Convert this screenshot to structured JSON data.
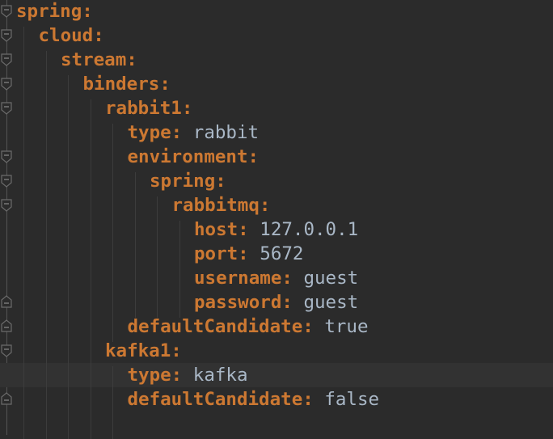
{
  "editor": {
    "language": "yaml",
    "colors": {
      "background": "#2b2b2b",
      "key": "#cc7832",
      "value": "#a9b7c6",
      "current_line": "#323232"
    },
    "current_line_index": 15,
    "lines": [
      {
        "indent": 0,
        "key": "spring",
        "value": ""
      },
      {
        "indent": 1,
        "key": "cloud",
        "value": ""
      },
      {
        "indent": 2,
        "key": "stream",
        "value": ""
      },
      {
        "indent": 3,
        "key": "binders",
        "value": ""
      },
      {
        "indent": 4,
        "key": "rabbit1",
        "value": ""
      },
      {
        "indent": 5,
        "key": "type",
        "value": "rabbit"
      },
      {
        "indent": 5,
        "key": "environment",
        "value": ""
      },
      {
        "indent": 6,
        "key": "spring",
        "value": ""
      },
      {
        "indent": 7,
        "key": "rabbitmq",
        "value": ""
      },
      {
        "indent": 8,
        "key": "host",
        "value": "127.0.0.1"
      },
      {
        "indent": 8,
        "key": "port",
        "value": "5672"
      },
      {
        "indent": 8,
        "key": "username",
        "value": "guest"
      },
      {
        "indent": 8,
        "key": "password",
        "value": "guest"
      },
      {
        "indent": 5,
        "key": "defaultCandidate",
        "value": "true"
      },
      {
        "indent": 4,
        "key": "kafka1",
        "value": ""
      },
      {
        "indent": 5,
        "key": "type",
        "value": "kafka"
      },
      {
        "indent": 5,
        "key": "defaultCandidate",
        "value": "false"
      }
    ],
    "fold_markers": [
      {
        "line": 0,
        "dir": "open"
      },
      {
        "line": 1,
        "dir": "open"
      },
      {
        "line": 2,
        "dir": "open"
      },
      {
        "line": 3,
        "dir": "open"
      },
      {
        "line": 4,
        "dir": "open"
      },
      {
        "line": 6,
        "dir": "open"
      },
      {
        "line": 7,
        "dir": "open"
      },
      {
        "line": 8,
        "dir": "open"
      },
      {
        "line": 12,
        "dir": "close"
      },
      {
        "line": 13,
        "dir": "close"
      },
      {
        "line": 14,
        "dir": "open"
      },
      {
        "line": 16,
        "dir": "close"
      }
    ]
  }
}
